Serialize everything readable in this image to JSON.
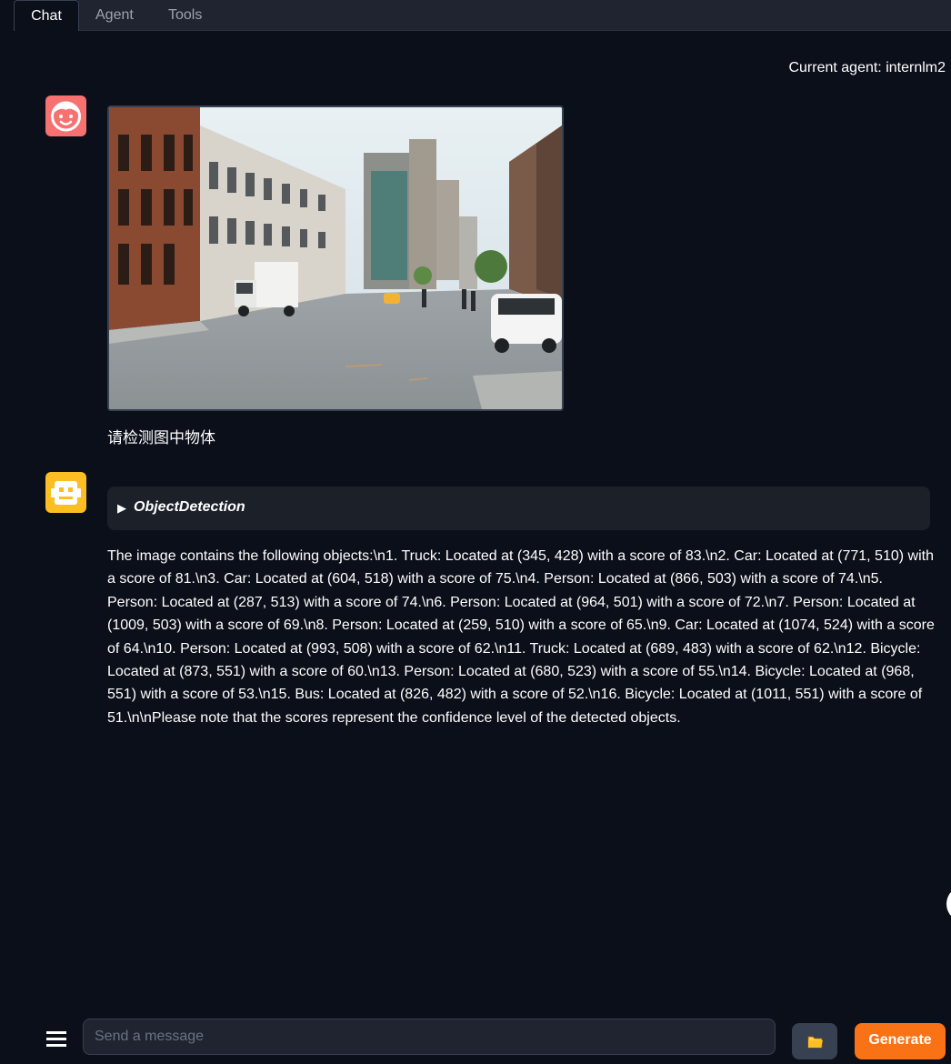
{
  "tabs": [
    {
      "label": "Chat",
      "active": true
    },
    {
      "label": "Agent",
      "active": false
    },
    {
      "label": "Tools",
      "active": false
    }
  ],
  "agent_label": "Current agent: internlm2",
  "messages": {
    "user": {
      "avatar": "smiley-face-icon",
      "image": "street-scene-photo",
      "text": "请检测图中物体"
    },
    "bot": {
      "avatar": "robot-icon",
      "tool_name": "ObjectDetection",
      "text": "The image contains the following objects:\\n1. Truck: Located at (345, 428) with a score of 83.\\n2. Car: Located at (771, 510) with a score of 81.\\n3. Car: Located at (604, 518) with a score of 75.\\n4. Person: Located at (866, 503) with a score of 74.\\n5. Person: Located at (287, 513) with a score of 74.\\n6. Person: Located at (964, 501) with a score of 72.\\n7. Person: Located at (1009, 503) with a score of 69.\\n8. Person: Located at (259, 510) with a score of 65.\\n9. Car: Located at (1074, 524) with a score of 64.\\n10. Person: Located at (993, 508) with a score of 62.\\n11. Truck: Located at (689, 483) with a score of 62.\\n12. Bicycle: Located at (873, 551) with a score of 60.\\n13. Person: Located at (680, 523) with a score of 55.\\n14. Bicycle: Located at (968, 551) with a score of 53.\\n15. Bus: Located at (826, 482) with a score of 52.\\n16. Bicycle: Located at (1011, 551) with a score of 51.\\n\\nPlease note that the scores represent the confidence level of the detected objects."
    }
  },
  "input": {
    "placeholder": "Send a message",
    "value": ""
  },
  "buttons": {
    "upload_icon": "folder-icon",
    "generate": "Generate"
  },
  "colors": {
    "background": "#0b0f19",
    "accent": "#f97316",
    "user_avatar": "#f87171",
    "bot_avatar": "#fbbf24"
  }
}
